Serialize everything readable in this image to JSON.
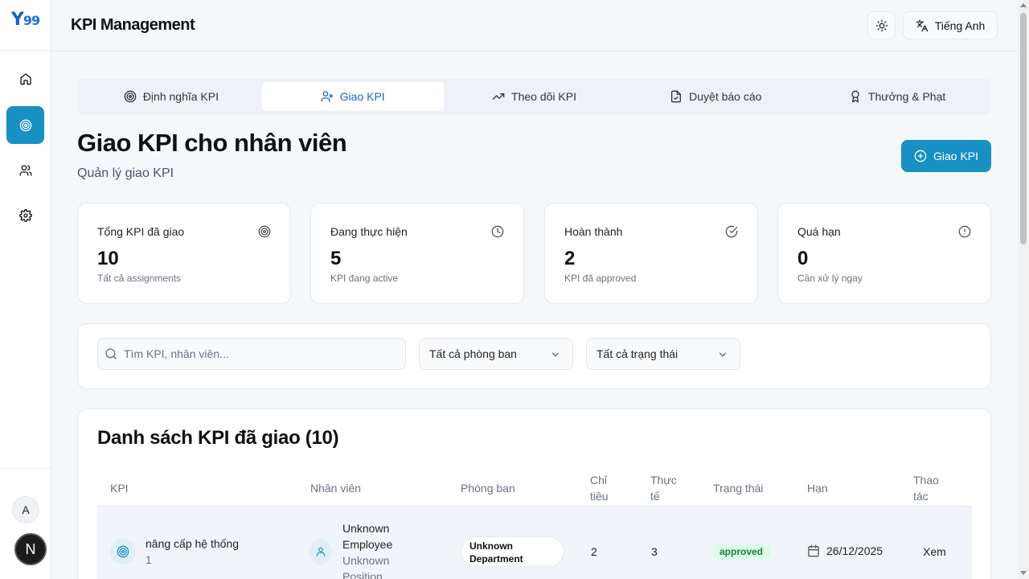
{
  "brand": {
    "logo_text": "Y",
    "logo_num": "99"
  },
  "header": {
    "title": "KPI Management",
    "language_label": "Tiếng Anh"
  },
  "sidebar": {
    "items": [
      {
        "name": "home",
        "icon": "home-icon"
      },
      {
        "name": "kpi",
        "icon": "target-icon",
        "active": true
      },
      {
        "name": "users",
        "icon": "users-icon"
      },
      {
        "name": "settings",
        "icon": "gear-icon"
      }
    ],
    "avatar_a": "A",
    "avatar_n": "N"
  },
  "tabs": [
    {
      "label": "Định nghĩa KPI",
      "icon": "target-icon"
    },
    {
      "label": "Giao KPI",
      "icon": "user-plus-icon",
      "active": true
    },
    {
      "label": "Theo dõi KPI",
      "icon": "trending-up-icon"
    },
    {
      "label": "Duyệt báo cáo",
      "icon": "file-check-icon"
    },
    {
      "label": "Thưởng & Phạt",
      "icon": "award-icon"
    }
  ],
  "page": {
    "title": "Giao KPI cho nhân viên",
    "subtitle": "Quản lý giao KPI",
    "primary_button": "Giao KPI"
  },
  "stats": [
    {
      "label": "Tổng KPI đã giao",
      "value": "10",
      "desc": "Tất cả assignments",
      "icon": "target-icon"
    },
    {
      "label": "Đang thực hiện",
      "value": "5",
      "desc": "KPI đang active",
      "icon": "clock-icon"
    },
    {
      "label": "Hoàn thành",
      "value": "2",
      "desc": "KPI đã approved",
      "icon": "check-circle-icon"
    },
    {
      "label": "Quá hạn",
      "value": "0",
      "desc": "Cần xử lý ngay",
      "icon": "alert-circle-icon"
    }
  ],
  "filters": {
    "search_placeholder": "Tìm KPI, nhân viên...",
    "department": "Tất cả phòng ban",
    "status": "Tất cả trạng thái"
  },
  "table": {
    "title": "Danh sách KPI đã giao (10)",
    "headers": {
      "kpi": "KPI",
      "employee": "Nhân viên",
      "department": "Phòng ban",
      "target_1": "Chỉ",
      "target_2": "tiêu",
      "actual_1": "Thực",
      "actual_2": "tế",
      "status": "Trạng thái",
      "deadline": "Hạn",
      "action_1": "Thao",
      "action_2": "tác"
    },
    "rows": [
      {
        "kpi_name": "nâng cấp hệ thống",
        "kpi_id": "1",
        "employee_name": "Unknown Employee",
        "employee_position": "Unknown Position",
        "department": "Unknown Department",
        "target": "2",
        "actual": "3",
        "status": "approved",
        "deadline": "26/12/2025",
        "action": "Xem"
      }
    ]
  }
}
